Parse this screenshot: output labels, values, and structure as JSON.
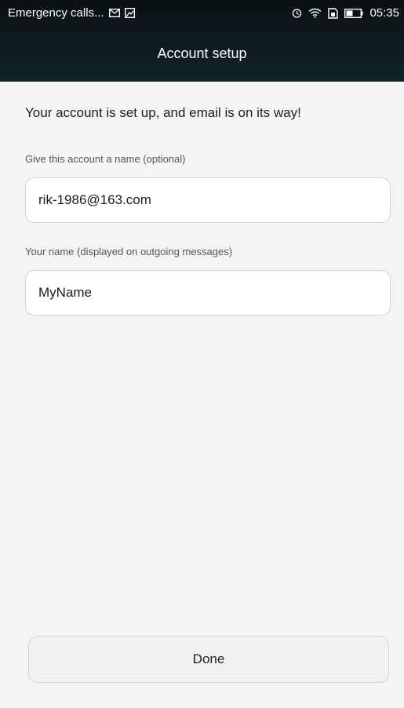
{
  "status_bar": {
    "carrier_text": "Emergency calls...",
    "time": "05:35",
    "icons": [
      "mail-icon",
      "image-icon",
      "alarm-icon",
      "wifi-icon",
      "sim-icon",
      "battery-icon"
    ]
  },
  "header": {
    "title": "Account setup"
  },
  "main": {
    "headline": "Your account is set up, and email is on its way!",
    "account_name": {
      "label": "Give this account a name (optional)",
      "value": "rik-1986@163.com"
    },
    "your_name": {
      "label": "Your name (displayed on outgoing messages)",
      "value": "MyName"
    }
  },
  "footer": {
    "done_label": "Done"
  },
  "colors": {
    "header_bg": "#0e1b1e",
    "page_bg": "#f4f4f4",
    "field_border": "#d4d4d4",
    "text": "#1d1d1d"
  }
}
